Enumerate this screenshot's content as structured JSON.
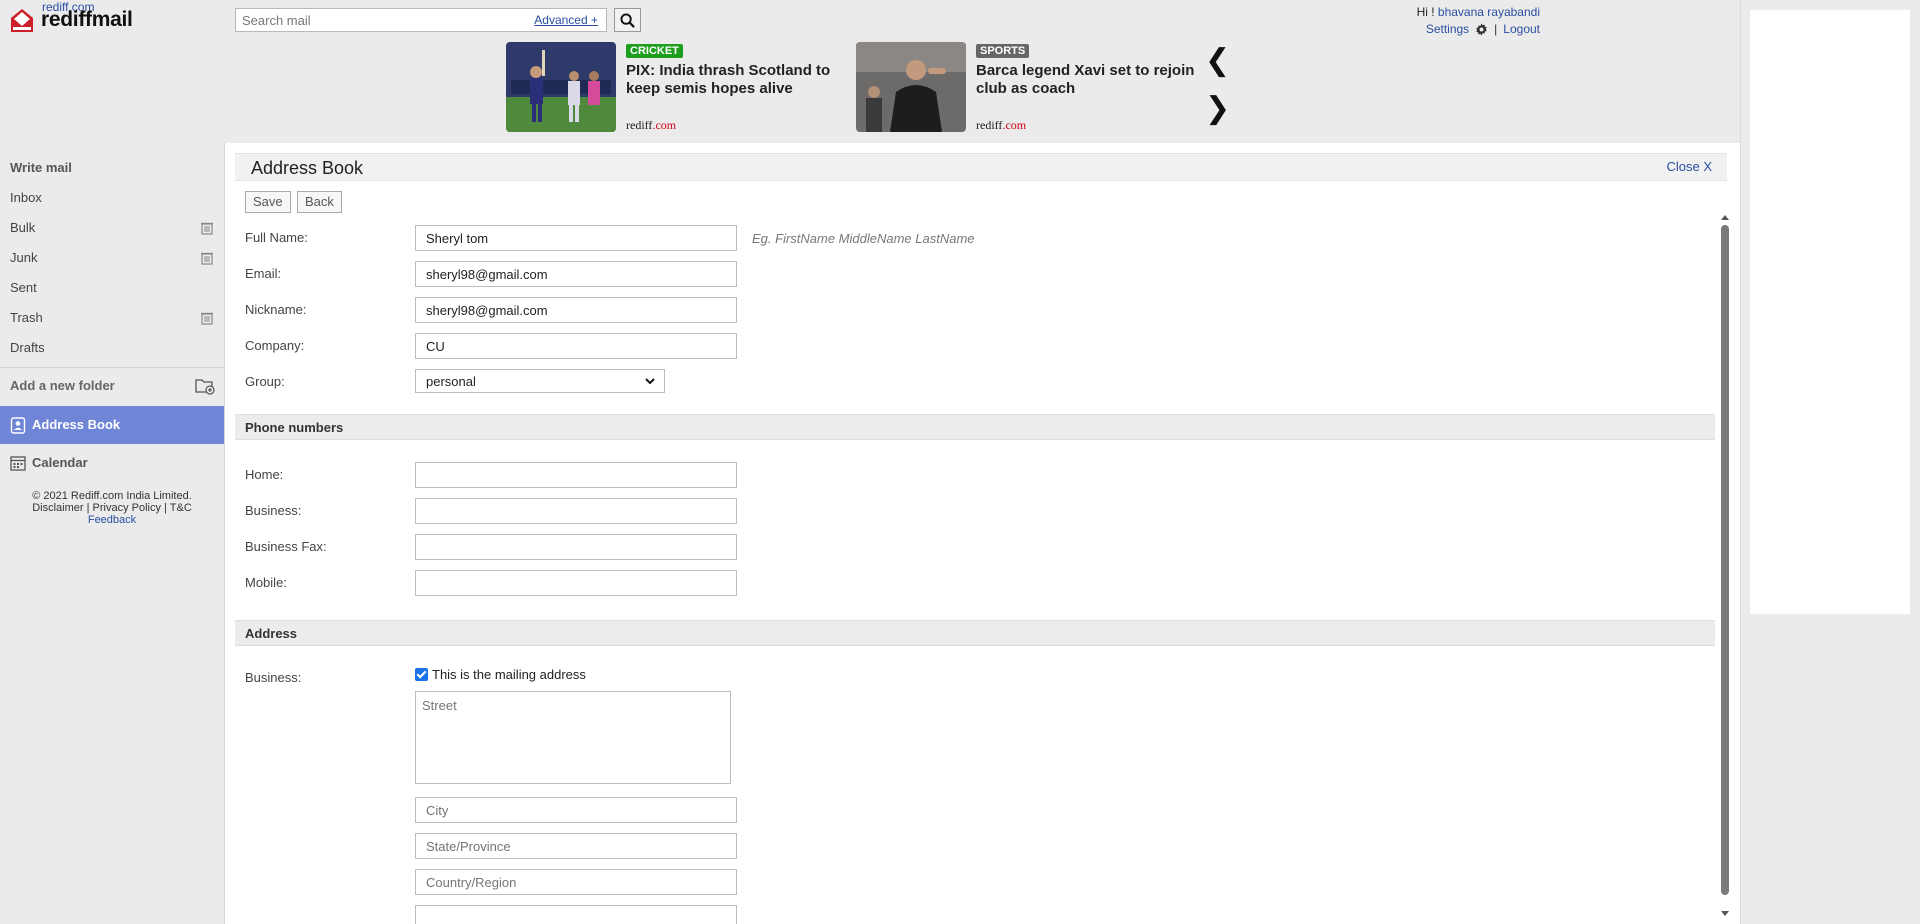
{
  "header": {
    "brand_small": "rediff.com",
    "brand": "rediffmail",
    "search_placeholder": "Search mail",
    "advanced_link": "Advanced +",
    "greeting": "Hi !",
    "user_name": "bhavana rayabandi",
    "settings_label": "Settings",
    "logout_label": "Logout",
    "separator": "|"
  },
  "news": [
    {
      "tag": "CRICKET",
      "tag_color": "#1e9e1e",
      "title": "PIX: India thrash Scotland to keep semis hopes alive",
      "source_a": "rediff",
      "source_b": ".com"
    },
    {
      "tag": "SPORTS",
      "tag_color": "#666666",
      "title": "Barca legend Xavi set to rejoin club as coach",
      "source_a": "rediff",
      "source_b": ".com"
    }
  ],
  "news_nav": {
    "prev": "❮",
    "next": "❯"
  },
  "sidebar": {
    "write_mail": "Write mail",
    "folders": [
      {
        "label": "Inbox",
        "trash": false
      },
      {
        "label": "Bulk",
        "trash": true
      },
      {
        "label": "Junk",
        "trash": true
      },
      {
        "label": "Sent",
        "trash": false
      },
      {
        "label": "Trash",
        "trash": true
      },
      {
        "label": "Drafts",
        "trash": false
      }
    ],
    "add_folder": "Add a new folder",
    "address_book": "Address Book",
    "calendar": "Calendar",
    "footer_copyright": "© 2021 Rediff.com India Limited.",
    "footer_disclaimer": "Disclaimer",
    "footer_privacy": "Privacy Policy",
    "footer_tc": "T&C",
    "footer_feedback": "Feedback",
    "footer_sep": "|"
  },
  "main": {
    "title": "Address Book",
    "close_label": "Close X",
    "save_label": "Save",
    "back_label": "Back",
    "fields": {
      "full_name": {
        "label": "Full Name:",
        "value": "Sheryl tom",
        "hint": "Eg. FirstName MiddleName LastName"
      },
      "email": {
        "label": "Email:",
        "value": "sheryl98@gmail.com"
      },
      "nickname": {
        "label": "Nickname:",
        "value": "sheryl98@gmail.com"
      },
      "company": {
        "label": "Company:",
        "value": "CU"
      },
      "group": {
        "label": "Group:",
        "value": "personal"
      }
    },
    "phone_section": "Phone numbers",
    "phones": {
      "home": {
        "label": "Home:",
        "value": ""
      },
      "business": {
        "label": "Business:",
        "value": ""
      },
      "business_fax": {
        "label": "Business Fax:",
        "value": ""
      },
      "mobile": {
        "label": "Mobile:",
        "value": ""
      }
    },
    "address_section": "Address",
    "address": {
      "label": "Business:",
      "mailing_checkbox_label": "This is the mailing address",
      "mailing_checked": true,
      "street_placeholder": "Street",
      "city_placeholder": "City",
      "state_placeholder": "State/Province",
      "country_placeholder": "Country/Region"
    }
  }
}
